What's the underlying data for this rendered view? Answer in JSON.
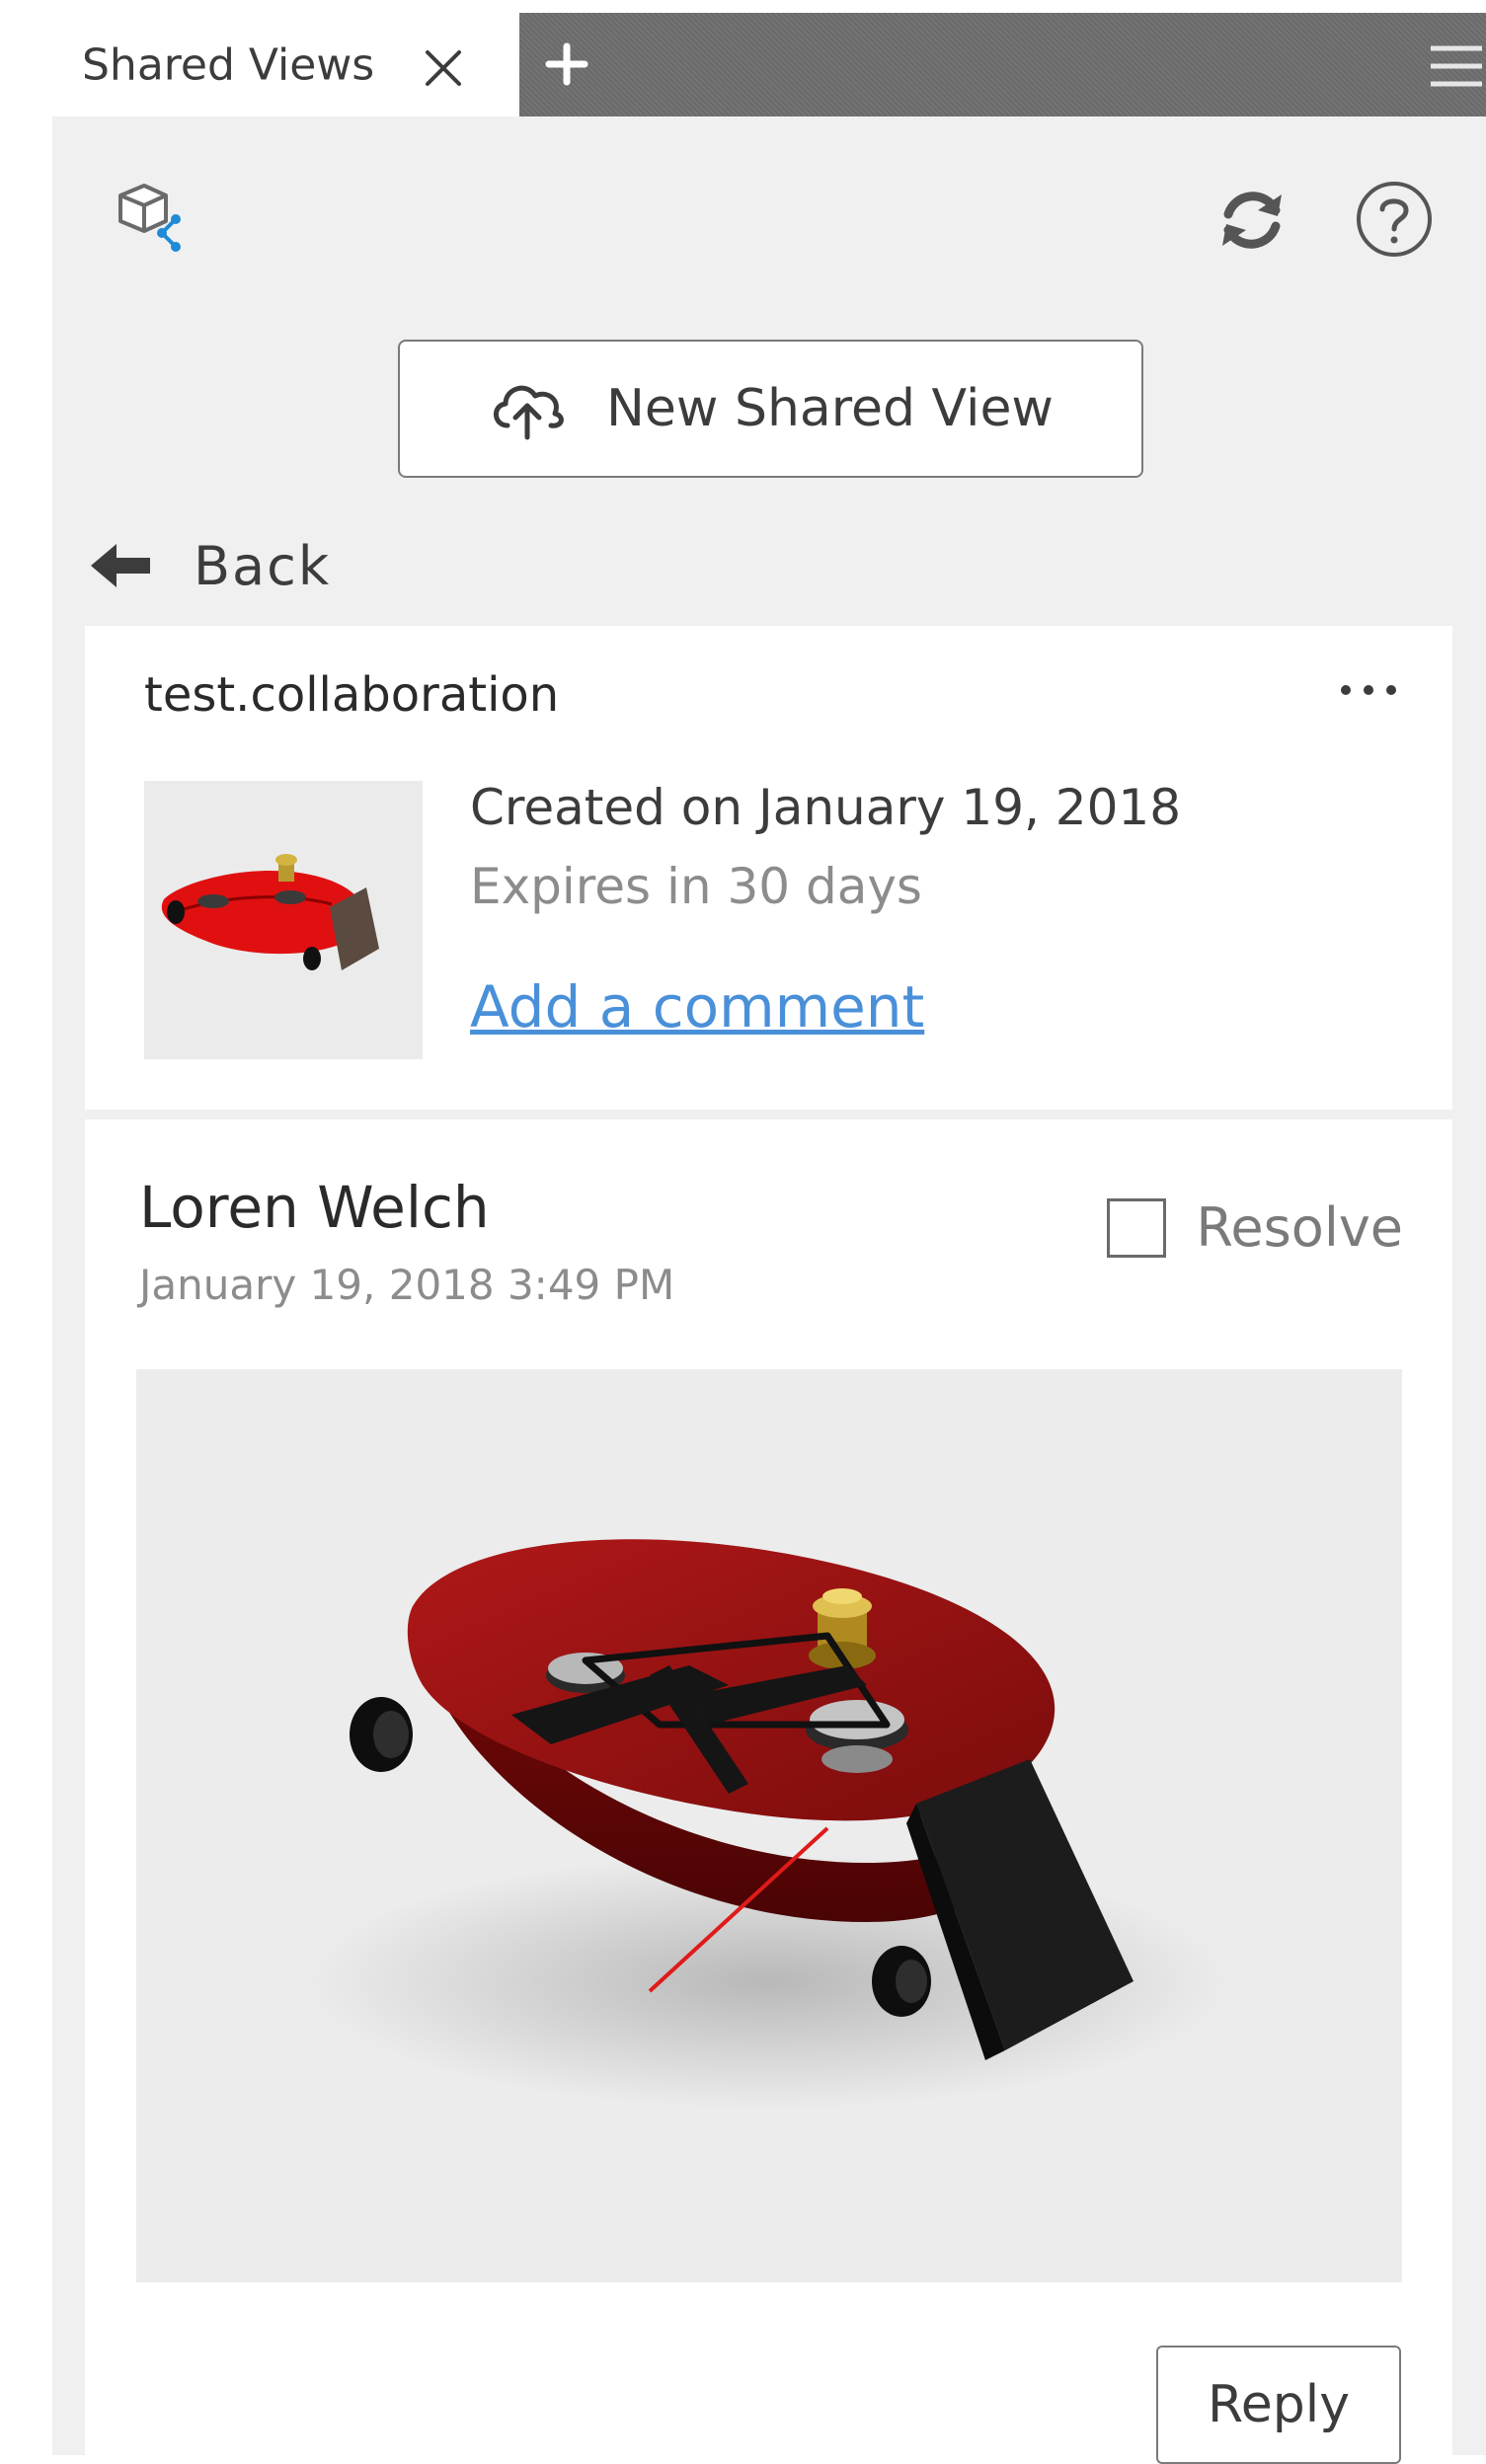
{
  "tabs": {
    "active_label": "Shared Views"
  },
  "toolbar": {
    "new_shared_view_label": "New Shared View",
    "back_label": "Back"
  },
  "shared_view": {
    "name": "test.collaboration",
    "created": "Created on January 19, 2018",
    "expires": "Expires in 30 days",
    "add_comment_label": "Add a comment"
  },
  "comment": {
    "author": "Loren Welch",
    "timestamp": "January 19, 2018 3:49 PM",
    "resolve_label": "Resolve",
    "resolved": false,
    "reply_label": "Reply"
  },
  "icons": {
    "close": "close-icon",
    "add_tab": "plus-icon",
    "menu": "hamburger-menu-icon",
    "share_model": "share-model-icon",
    "refresh": "refresh-icon",
    "help": "help-icon",
    "upload": "cloud-upload-icon",
    "back": "arrow-left-icon",
    "more": "more-options-icon"
  },
  "colors": {
    "link": "#4a90d9",
    "panel_bg": "#f0f0f0",
    "tab_bar_dark": "#6e6e6e",
    "accent_share": "#1f8ad6",
    "model_red": "#c01818"
  }
}
